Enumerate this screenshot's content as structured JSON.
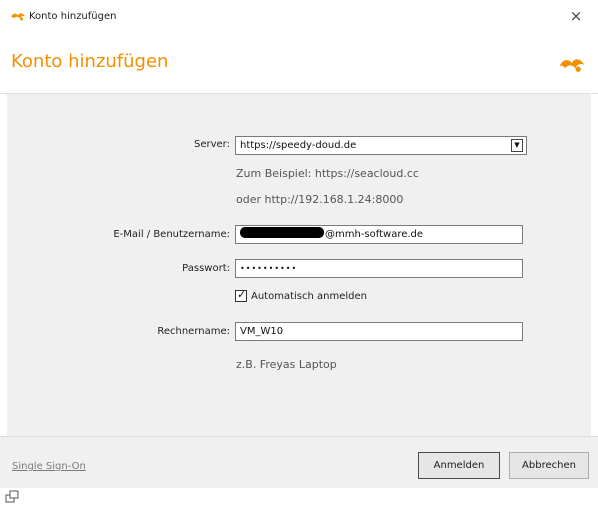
{
  "window": {
    "title": "Konto hinzufügen",
    "close_glyph": "×",
    "icon": "seafile-logo-icon"
  },
  "banner": {
    "heading": "Konto hinzufügen",
    "accent_color": "#f29000",
    "logo": "seafile-logo-icon"
  },
  "form": {
    "server": {
      "label": "Server:",
      "value": "https://speedy-doud.de",
      "dropdown_glyph": "▼"
    },
    "server_hint_1": "Zum Beispiel: https://seacloud.cc",
    "server_hint_2": "oder http://192.168.1.24:8000",
    "email": {
      "label": "E-Mail / Benutzername:",
      "value_suffix": "@mmh-software.de"
    },
    "password": {
      "label": "Passwort:",
      "value": "••••••••••"
    },
    "auto_login": {
      "label": "Automatisch anmelden",
      "checked": true,
      "tick": "✓"
    },
    "computer_name": {
      "label": "Rechnername:",
      "value": "VM_W10"
    },
    "computer_name_hint": "z.B. Freyas Laptop"
  },
  "footer": {
    "sso_link": "Single Sign-On",
    "login_button": "Anmelden",
    "cancel_button": "Abbrechen"
  },
  "icons": {
    "resize": "window-resize-icon"
  }
}
